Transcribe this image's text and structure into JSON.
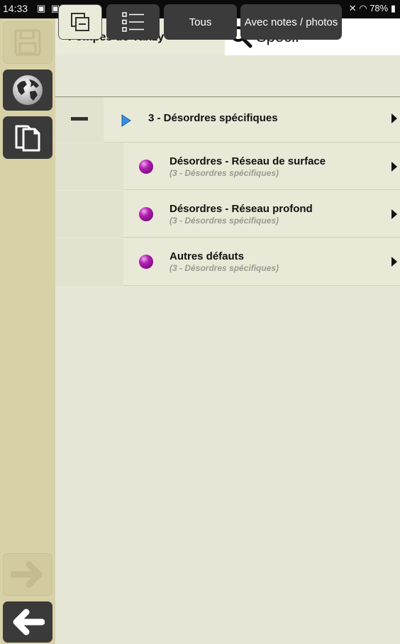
{
  "status_bar": {
    "time": "14:33",
    "battery": "78%"
  },
  "header": {
    "project_title": "Pompes de Vanzy",
    "search_value": "Specif"
  },
  "toolbar": {
    "all_label": "Tous",
    "with_notes_label": "Avec notes / photos"
  },
  "category": {
    "title": "3 - Désordres spécifiques"
  },
  "items": [
    {
      "title": "Désordres - Réseau de surface",
      "subtitle": "(3 - Désordres spécifiques)"
    },
    {
      "title": "Désordres - Réseau profond",
      "subtitle": "(3 - Désordres spécifiques)"
    },
    {
      "title": "Autres défauts",
      "subtitle": "(3 - Désordres spécifiques)"
    }
  ],
  "colors": {
    "background": "#e6e7d6",
    "rail": "#d8d1a8",
    "dark_button": "#3a3a3a",
    "sphere": "#a020a0",
    "play_triangle": "#3a8ee0"
  }
}
